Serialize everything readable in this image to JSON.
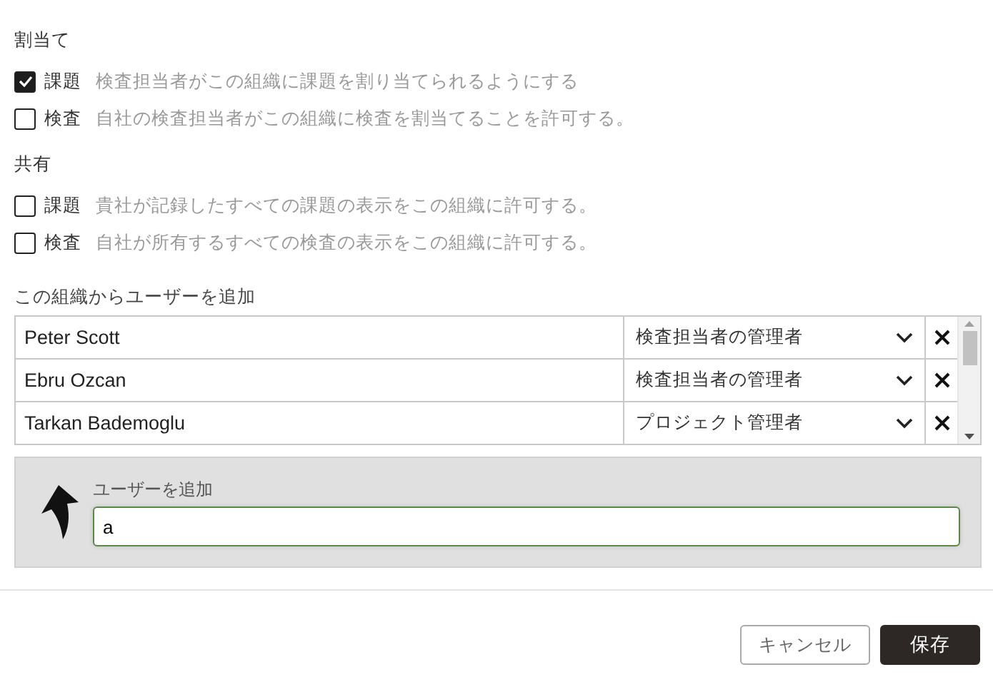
{
  "permission_groups": [
    {
      "title": "割当て",
      "options": [
        {
          "label": "課題",
          "description": "検査担当者がこの組織に課題を割り当てられるようにする",
          "checked": true
        },
        {
          "label": "検査",
          "description": "自社の検査担当者がこの組織に検査を割当てることを許可する。",
          "checked": false
        }
      ]
    },
    {
      "title": "共有",
      "options": [
        {
          "label": "課題",
          "description": "貴社が記録したすべての課題の表示をこの組織に許可する。",
          "checked": false
        },
        {
          "label": "検査",
          "description": "自社が所有するすべての検査の表示をこの組織に許可する。",
          "checked": false
        }
      ]
    }
  ],
  "users": {
    "title": "この組織からユーザーを追加",
    "rows": [
      {
        "name": "Peter Scott",
        "role": "検査担当者の管理者"
      },
      {
        "name": "Ebru Ozcan",
        "role": "検査担当者の管理者"
      },
      {
        "name": "Tarkan Bademoglu",
        "role": "プロジェクト管理者"
      }
    ]
  },
  "add_user": {
    "label": "ユーザーを追加",
    "value": "a"
  },
  "buttons": [
    {
      "kind": "secondary",
      "label": "キャンセル"
    },
    {
      "kind": "primary",
      "label": "保存"
    }
  ]
}
